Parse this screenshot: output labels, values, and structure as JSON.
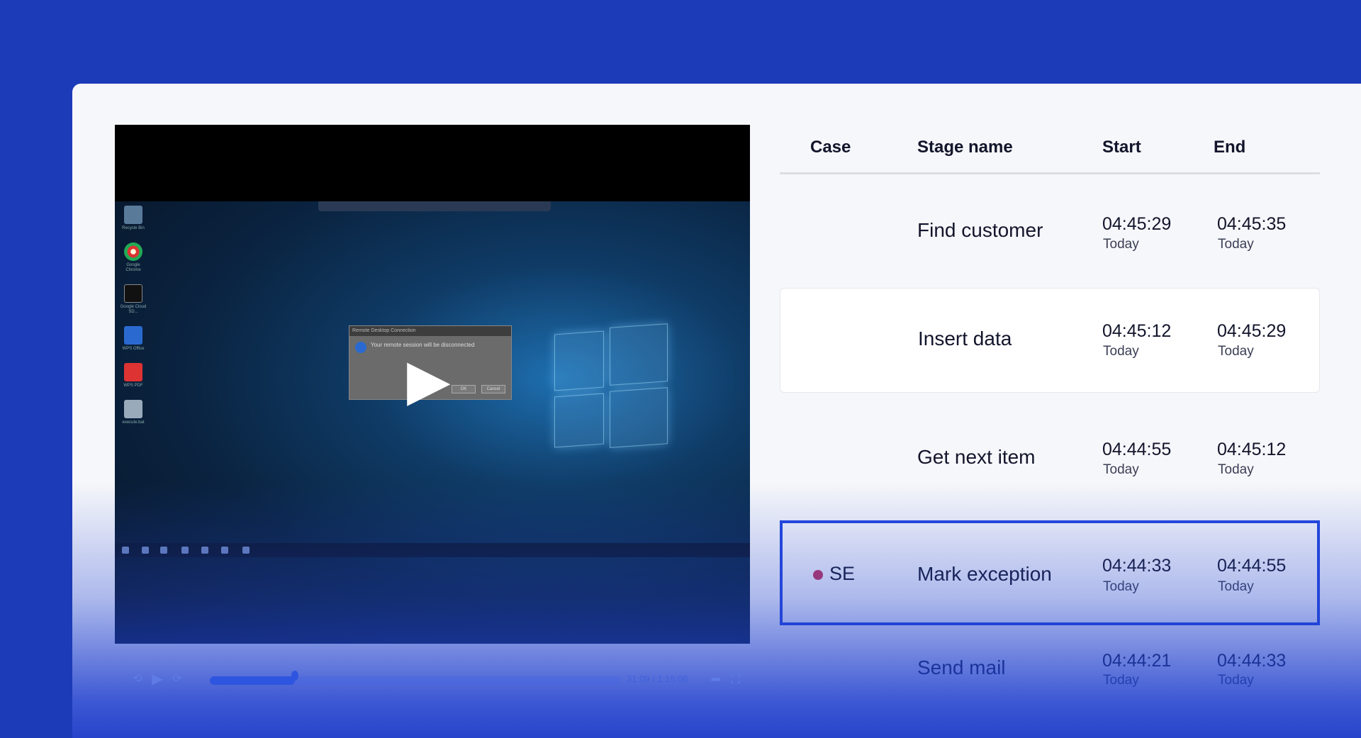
{
  "table": {
    "headers": {
      "case": "Case",
      "stage": "Stage name",
      "start": "Start",
      "end": "End"
    },
    "rows": [
      {
        "case": "",
        "stage": "Find customer",
        "start_time": "04:45:29",
        "start_day": "Today",
        "end_time": "04:45:35",
        "end_day": "Today"
      },
      {
        "case": "",
        "stage": "Insert data",
        "start_time": "04:45:12",
        "start_day": "Today",
        "end_time": "04:45:29",
        "end_day": "Today"
      },
      {
        "case": "",
        "stage": "Get next item",
        "start_time": "04:44:55",
        "start_day": "Today",
        "end_time": "04:45:12",
        "end_day": "Today"
      },
      {
        "case": "SE",
        "case_status_color": "#c4315b",
        "stage": "Mark exception",
        "start_time": "04:44:33",
        "start_day": "Today",
        "end_time": "04:44:55",
        "end_day": "Today"
      },
      {
        "case": "",
        "stage": "Send mail",
        "start_time": "04:44:21",
        "start_day": "Today",
        "end_time": "04:44:33",
        "end_day": "Today"
      }
    ],
    "selected_row": 3
  },
  "player": {
    "time": "31:09 / 1:15:06",
    "progress": 0.2075,
    "dialog": {
      "title": "Remote Desktop Connection",
      "message": "Your remote session will be disconnected",
      "ok": "OK",
      "cancel": "Cancel"
    },
    "desktop_icons": [
      "Recycle Bin",
      "Google Chrome",
      "Google Cloud SD...",
      "WPS Office",
      "WPS PDF",
      "execute.bat"
    ]
  },
  "colors": {
    "background": "#1c3bb9",
    "accent": "#2346dc",
    "exception_dot": "#c4315b"
  }
}
